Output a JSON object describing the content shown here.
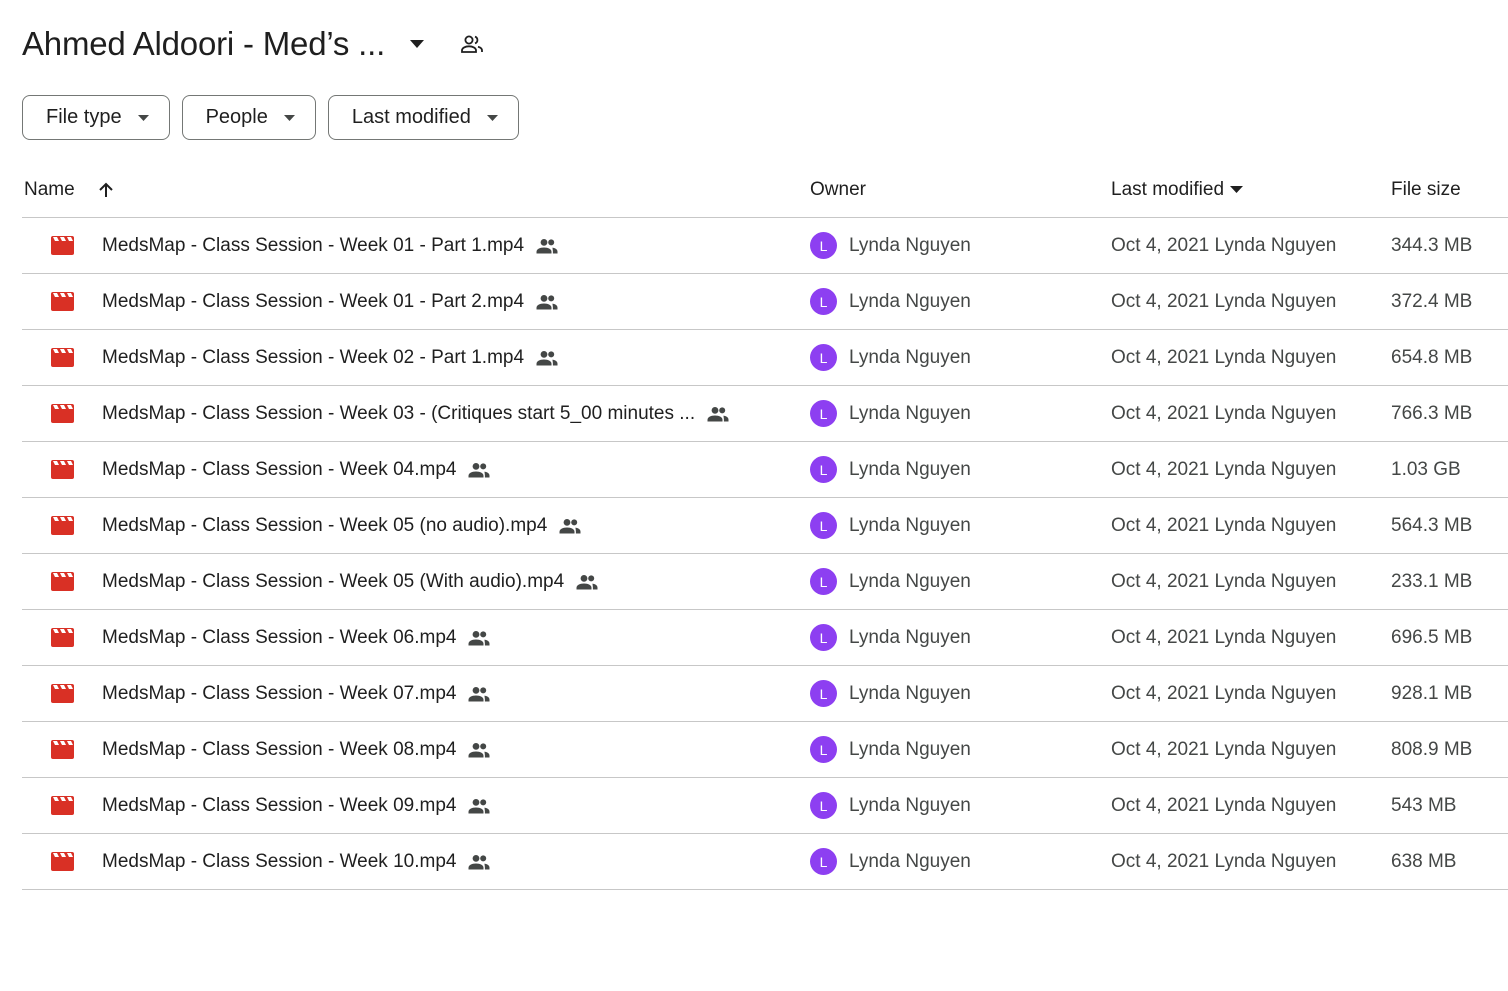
{
  "header": {
    "title": "Ahmed Aldoori - Med’s ..."
  },
  "filters": [
    {
      "label": "File type"
    },
    {
      "label": "People"
    },
    {
      "label": "Last modified"
    }
  ],
  "columns": {
    "name": "Name",
    "owner": "Owner",
    "modified": "Last modified",
    "size": "File size"
  },
  "colors": {
    "avatar": "#8d3ff1",
    "video_icon": "#d93025"
  },
  "rows": [
    {
      "name": "MedsMap - Class Session - Week 01 - Part 1.mp4",
      "owner_initial": "L",
      "owner": "Lynda Nguyen",
      "modified": "Oct 4, 2021 Lynda Nguyen",
      "size": "344.3 MB"
    },
    {
      "name": "MedsMap - Class Session - Week 01 - Part 2.mp4",
      "owner_initial": "L",
      "owner": "Lynda Nguyen",
      "modified": "Oct 4, 2021 Lynda Nguyen",
      "size": "372.4 MB"
    },
    {
      "name": "MedsMap - Class Session - Week 02 - Part 1.mp4",
      "owner_initial": "L",
      "owner": "Lynda Nguyen",
      "modified": "Oct 4, 2021 Lynda Nguyen",
      "size": "654.8 MB"
    },
    {
      "name": "MedsMap - Class Session - Week 03 - (Critiques start 5_00 minutes ...",
      "owner_initial": "L",
      "owner": "Lynda Nguyen",
      "modified": "Oct 4, 2021 Lynda Nguyen",
      "size": "766.3 MB"
    },
    {
      "name": "MedsMap - Class Session - Week 04.mp4",
      "owner_initial": "L",
      "owner": "Lynda Nguyen",
      "modified": "Oct 4, 2021 Lynda Nguyen",
      "size": "1.03 GB"
    },
    {
      "name": "MedsMap - Class Session - Week 05 (no audio).mp4",
      "owner_initial": "L",
      "owner": "Lynda Nguyen",
      "modified": "Oct 4, 2021 Lynda Nguyen",
      "size": "564.3 MB"
    },
    {
      "name": "MedsMap - Class Session - Week 05 (With audio).mp4",
      "owner_initial": "L",
      "owner": "Lynda Nguyen",
      "modified": "Oct 4, 2021 Lynda Nguyen",
      "size": "233.1 MB"
    },
    {
      "name": "MedsMap - Class Session - Week 06.mp4",
      "owner_initial": "L",
      "owner": "Lynda Nguyen",
      "modified": "Oct 4, 2021 Lynda Nguyen",
      "size": "696.5 MB"
    },
    {
      "name": "MedsMap - Class Session - Week 07.mp4",
      "owner_initial": "L",
      "owner": "Lynda Nguyen",
      "modified": "Oct 4, 2021 Lynda Nguyen",
      "size": "928.1 MB"
    },
    {
      "name": "MedsMap - Class Session - Week 08.mp4",
      "owner_initial": "L",
      "owner": "Lynda Nguyen",
      "modified": "Oct 4, 2021 Lynda Nguyen",
      "size": "808.9 MB"
    },
    {
      "name": "MedsMap - Class Session - Week 09.mp4",
      "owner_initial": "L",
      "owner": "Lynda Nguyen",
      "modified": "Oct 4, 2021 Lynda Nguyen",
      "size": "543 MB"
    },
    {
      "name": "MedsMap - Class Session - Week 10.mp4",
      "owner_initial": "L",
      "owner": "Lynda Nguyen",
      "modified": "Oct 4, 2021 Lynda Nguyen",
      "size": "638 MB"
    }
  ]
}
